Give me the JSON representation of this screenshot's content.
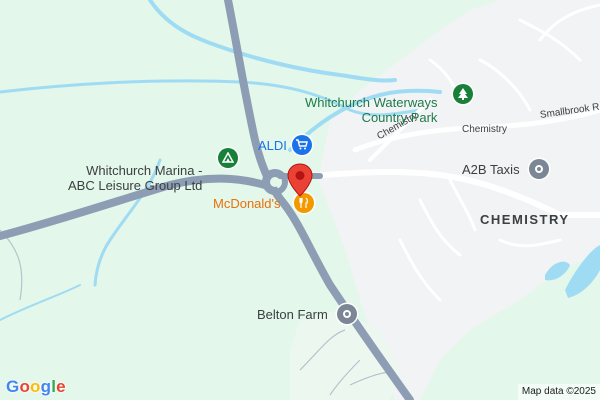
{
  "map": {
    "labels": {
      "waterways_park": "Whitchurch Waterways\nCountry Park",
      "aldi": "ALDI",
      "marina": "Whitchurch Marina -\nABC Leisure Group Ltd",
      "mcdonalds": "McDonald's",
      "a2b_taxis": "A2B Taxis",
      "chemistry_area": "CHEMISTRY",
      "chemistry_street_1": "Chemistry",
      "chemistry_street_2": "Chemistry",
      "smallbrook_road": "Smallbrook R",
      "belton_farm": "Belton Farm"
    },
    "icons": {
      "park": "tree-icon",
      "aldi": "shopping-cart-icon",
      "marina": "campground-icon",
      "mcdonalds": "restaurant-icon",
      "a2b_taxis": "generic-poi-icon",
      "belton_farm": "generic-poi-icon",
      "pin": "location-pin-icon"
    },
    "colors": {
      "land": "#e3f7ea",
      "urban": "#f1f3f4",
      "water": "#9fdcf3",
      "major_road": "#8d9db3",
      "minor_road": "#ffffff",
      "park_green": "#188038",
      "shop_blue": "#1a73e8",
      "food_orange": "#f29900",
      "pin_red": "#ea4335"
    },
    "logo": "Google",
    "attribution": "Map data ©2025"
  }
}
